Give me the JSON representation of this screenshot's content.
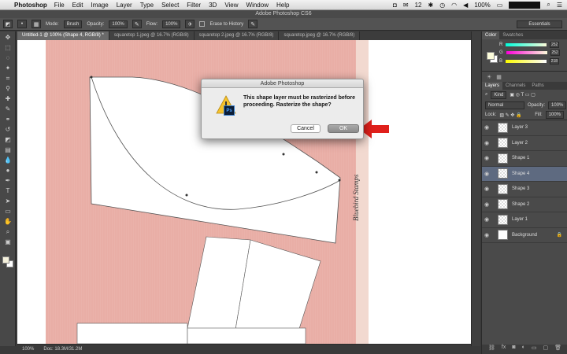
{
  "menubar": {
    "app": "Photoshop",
    "items": [
      "File",
      "Edit",
      "Image",
      "Layer",
      "Type",
      "Select",
      "Filter",
      "3D",
      "View",
      "Window",
      "Help"
    ],
    "battery": "100%",
    "network_count": "12"
  },
  "window_title": "Adobe Photoshop CS6",
  "options": {
    "mode_label": "Mode:",
    "mode_value": "Brush",
    "opacity_label": "Opacity:",
    "opacity_value": "100%",
    "flow_label": "Flow:",
    "flow_value": "100%",
    "erase_history": "Erase to History",
    "workspace": "Essentials"
  },
  "tabs": [
    "Untitled-1 @ 100% (Shape 4, RGB/8) *",
    "squaretop 1.jpeg @ 16.7% (RGB/8)",
    "squaretop 2.jpeg @ 16.7% (RGB/8)",
    "squaretop.jpeg @ 16.7% (RGB/8)"
  ],
  "status": {
    "zoom": "100%",
    "doc": "Doc: 18.3M/31.2M"
  },
  "canvas": {
    "signature": "Bluebird Stamps"
  },
  "color_panel": {
    "tabs": [
      "Color",
      "Swatches"
    ],
    "r_label": "R",
    "r": "252",
    "g_label": "G",
    "g": "252",
    "b_label": "B",
    "b": "218"
  },
  "layers_panel": {
    "tabs": [
      "Layers",
      "Channels",
      "Paths"
    ],
    "kind": "Kind",
    "blend": "Normal",
    "opacity_label": "Opacity:",
    "opacity": "100%",
    "lock_label": "Lock:",
    "fill_label": "Fill:",
    "fill": "100%",
    "layers": [
      {
        "name": "Layer 3",
        "type": "raster"
      },
      {
        "name": "Layer 2",
        "type": "raster"
      },
      {
        "name": "Shape 1",
        "type": "shape"
      },
      {
        "name": "Shape 4",
        "type": "shape",
        "selected": true
      },
      {
        "name": "Shape 3",
        "type": "shape"
      },
      {
        "name": "Shape 2",
        "type": "shape"
      },
      {
        "name": "Layer 1",
        "type": "raster"
      },
      {
        "name": "Background",
        "type": "background"
      }
    ]
  },
  "dialog": {
    "title": "Adobe Photoshop",
    "message": "This shape layer must be rasterized before proceeding.  Rasterize the shape?",
    "cancel": "Cancel",
    "ok": "OK",
    "icon_label": "Ps"
  },
  "colors": {
    "accent_arrow": "#e0201b",
    "paper": "#e9aea6",
    "selected_layer": "#5e6a80"
  }
}
